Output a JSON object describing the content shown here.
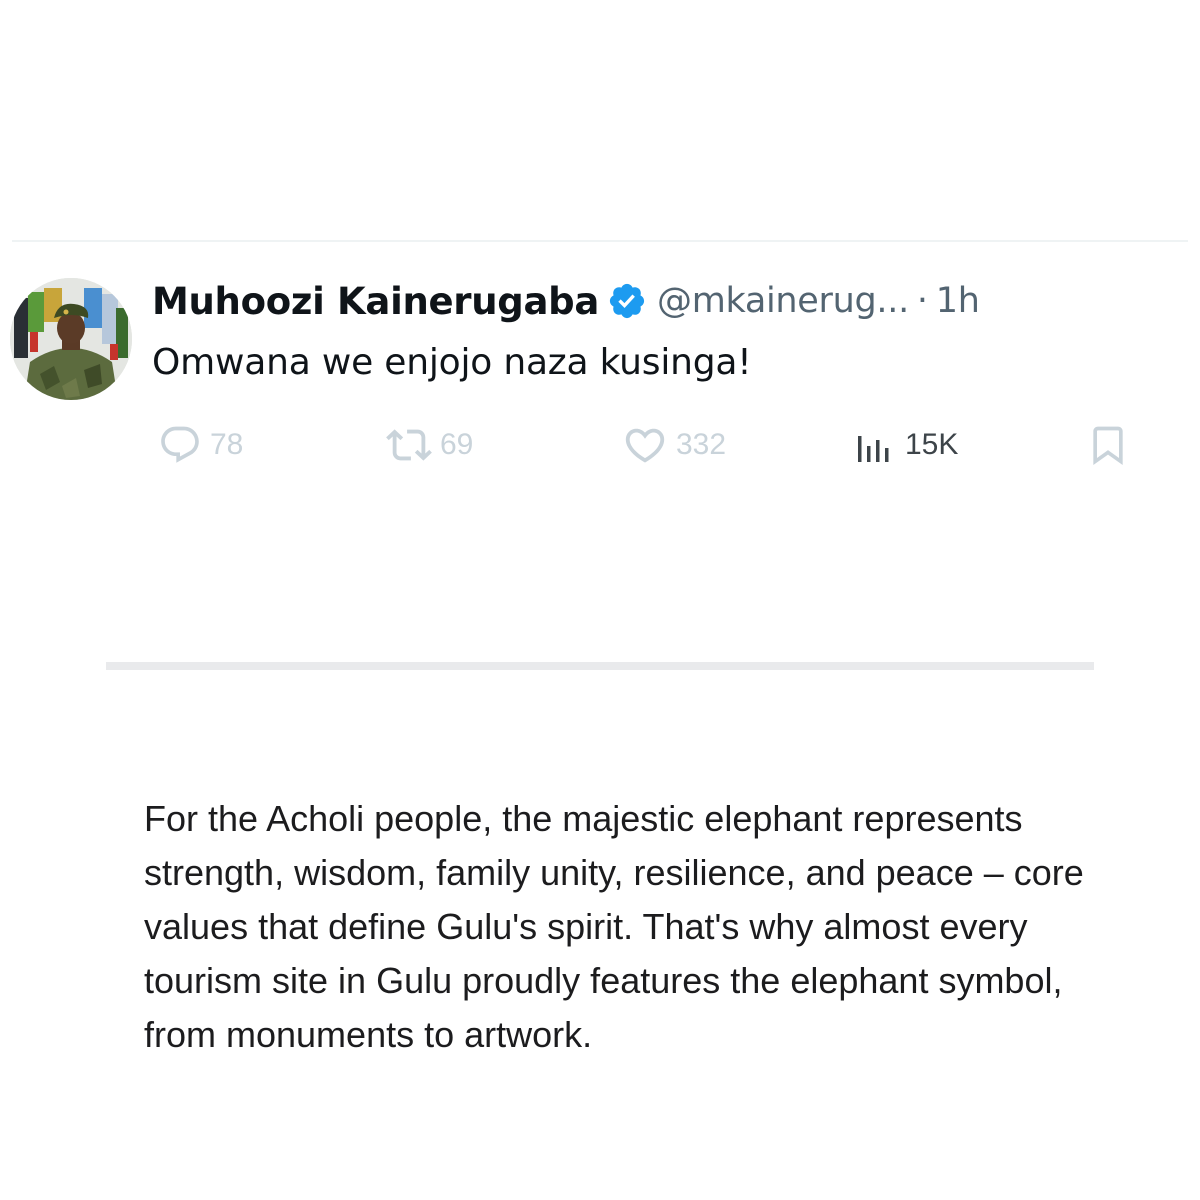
{
  "tweet": {
    "display_name": "Muhoozi Kainerugaba",
    "handle": "@mkainerug...",
    "separator": "·",
    "time": "1h",
    "text": "Omwana we enjojo naza kusinga!",
    "verified_color": "#1d9bf0",
    "actions": {
      "reply_count": "78",
      "retweet_count": "69",
      "like_count": "332",
      "views_count": "15K"
    },
    "icons": {
      "reply": "reply-icon",
      "retweet": "retweet-icon",
      "like": "heart-icon",
      "views": "views-bar-chart-icon",
      "bookmark": "bookmark-icon",
      "verified": "verified-badge-icon"
    }
  },
  "caption": "For the Acholi people, the majestic elephant represents strength, wisdom, family unity, resilience, and peace – core values that define Gulu's spirit. That's why almost every tourism site in Gulu proudly features the elephant symbol, from monuments to artwork."
}
